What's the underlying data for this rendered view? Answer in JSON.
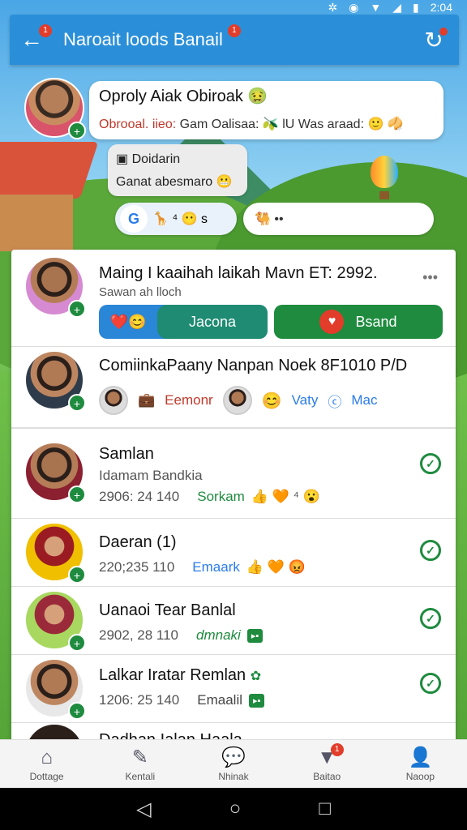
{
  "status": {
    "time": "2:04"
  },
  "appbar": {
    "title": "Naroait loods Banail",
    "back_badge": "1",
    "title_badge": "1"
  },
  "top_chat": {
    "name": "Oproly Aiak Obiroak",
    "msg_lead": "Obrooal. iieo:",
    "msg_rest": "Gam Oalisaa: 🫒 lU Was araad: 🙂 🥠",
    "card_title": "Doidarin",
    "card_sub": "Ganat abesmaro 😬",
    "pill_google": "G",
    "pill_text": "🦒 ⁴ 😶 s",
    "pill2_text": "🐫 ••"
  },
  "rows": [
    {
      "name": "Maing I kaaihah laikah Mavn ET: 2992.",
      "sub": "Sawan ah lloch",
      "btn1": "Jacona",
      "btn2": "Bsand"
    },
    {
      "name": "ComiinkaPaany Nanpan Noek 8F1010 P/D",
      "chip1": "Eemonr",
      "chip2": "Vaty",
      "chip3": "Mac"
    },
    {
      "name": "Samlan",
      "sub": "Idamam Bandkia",
      "time": "2906: 24 140",
      "tag": "Sorkam",
      "icons": "👍 🧡 ⁴ 😮"
    },
    {
      "name": "Daeran (1)",
      "time": "220;235 110",
      "tag": "Emaark",
      "icons": "👍 🧡 😡"
    },
    {
      "name": "Uanaoi Tear Banlal",
      "time": "2902, 28 110",
      "tag": "dmnaki"
    },
    {
      "name": "Lalkar Iratar Remlan",
      "time": "1206: 25 140",
      "tag": "Emaalil"
    },
    {
      "name": "Dadhan Ialan Haala"
    }
  ],
  "bottom_nav": [
    {
      "label": "Dottage",
      "icon": "home-icon"
    },
    {
      "label": "Kentali",
      "icon": "pencil-icon"
    },
    {
      "label": "Nhinak",
      "icon": "chat-icon"
    },
    {
      "label": "Baitao",
      "icon": "tag-icon",
      "badge": "1"
    },
    {
      "label": "Naoop",
      "icon": "person-icon"
    }
  ],
  "colors": {
    "primary": "#2a8fd8",
    "green": "#1e8b3e",
    "red": "#e23c2a"
  }
}
